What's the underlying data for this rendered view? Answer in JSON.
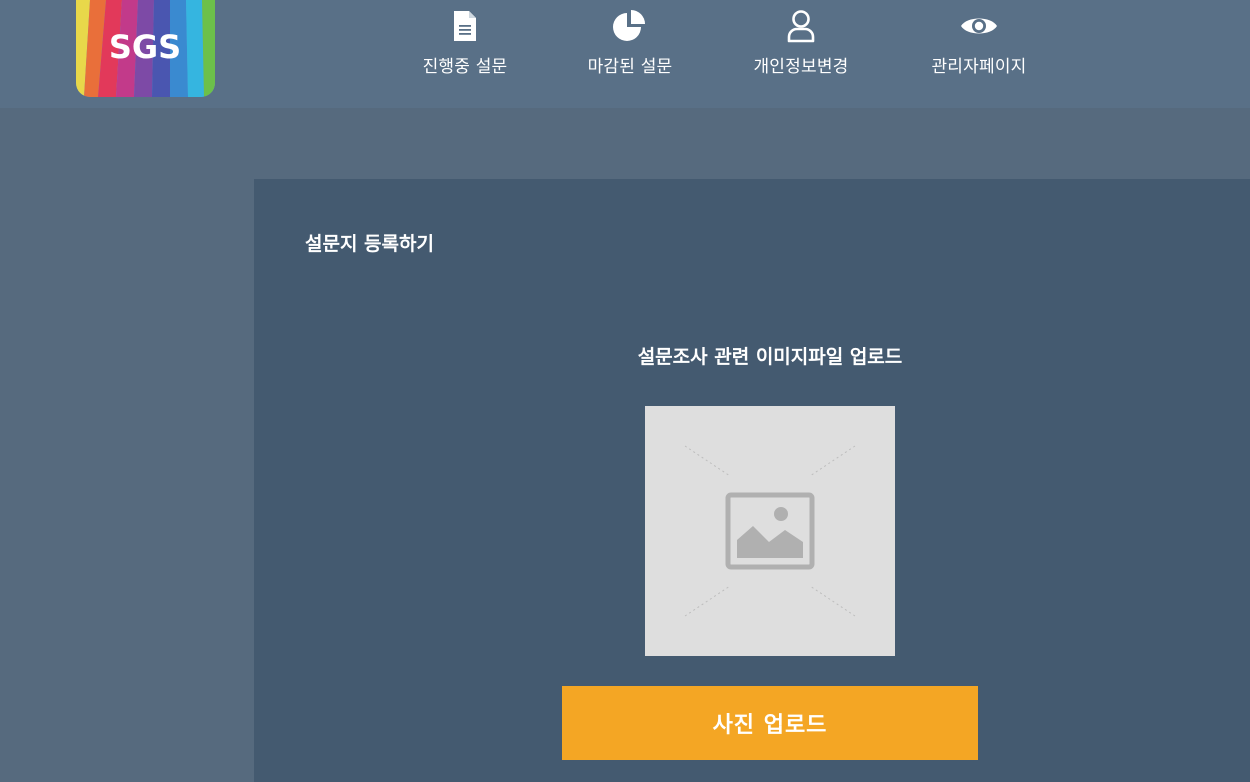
{
  "logo": {
    "text": "SGS"
  },
  "nav": {
    "items": [
      {
        "label": "진행중 설문",
        "icon": "document-icon"
      },
      {
        "label": "마감된 설문",
        "icon": "pie-chart-icon"
      },
      {
        "label": "개인정보변경",
        "icon": "user-icon"
      },
      {
        "label": "관리자페이지",
        "icon": "eye-icon"
      }
    ]
  },
  "panel": {
    "title": "설문지 등록하기",
    "upload_title": "설문조사 관련 이미지파일 업로드",
    "preview_icon": "image-placeholder-icon",
    "upload_button_label": "사진 업로드"
  },
  "colors": {
    "header_bg": "#597087",
    "page_bg": "#566a7e",
    "panel_bg": "#445a70",
    "button_bg": "#f4a624",
    "preview_bg": "#dedede"
  }
}
